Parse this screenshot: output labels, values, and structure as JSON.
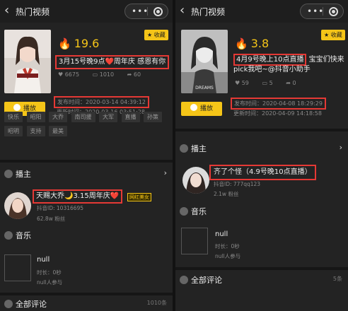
{
  "colors": {
    "accent": "#f5c518",
    "highlight": "#e53935",
    "background": "#232323"
  },
  "left": {
    "nav_title": "热门视频",
    "score": "19.6",
    "tag_button": "★ 收藏",
    "video_title": "3月15号晚9点❤️周年庆 感恩有你",
    "stats": {
      "likes": "6675",
      "comments": "1010",
      "shares": "60"
    },
    "publish_time": "发布时间：2020-03-14 04:39:12",
    "update_time": "更新时间：2020-03-16 03:51:28",
    "play_label": "播放",
    "tags": [
      "快乐",
      "昭阳",
      "大乔",
      "南司援",
      "大军",
      "直播",
      "孙策",
      "昭明",
      "支持",
      "最美"
    ],
    "anchor_section": "播主",
    "anchor_name": "天赐大乔🌙3.15周年庆❤️",
    "anchor_badge": "网红美女",
    "anchor_id": "抖音ID: 10316695",
    "anchor_fans": "62.8w 粉丝",
    "music_section": "音乐",
    "music_name": "null",
    "music_duration": "时长：0秒",
    "music_users": "null人参与",
    "comments_section": "全部评论",
    "comments_count": "1010条"
  },
  "right": {
    "nav_title": "热门视频",
    "score": "3.8",
    "tag_button": "★ 收藏",
    "video_title_hl": "4月9号晚上10点直播",
    "video_title_rest": "宝宝们快来pick我吧~@抖音小助手",
    "stats": {
      "likes": "59",
      "comments": "5",
      "shares": "0"
    },
    "publish_time": "发布时间：2020-04-08 18:29:29",
    "update_time": "更新时间：2020-04-09 14:18:58",
    "play_label": "播放",
    "anchor_section": "播主",
    "anchor_name": "齐了个怪（4.9号晚10点直播）",
    "anchor_id": "抖音ID: 777qq123",
    "anchor_fans": "2.1w 粉丝",
    "music_section": "音乐",
    "music_name": "null",
    "music_duration": "时长：0秒",
    "music_users": "null人参与",
    "comments_section": "全部评论",
    "comments_count": "5条"
  }
}
